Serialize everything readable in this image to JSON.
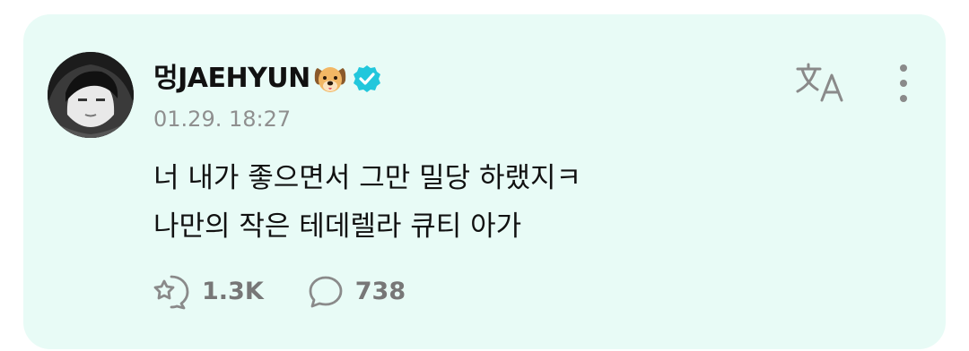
{
  "post": {
    "author": {
      "name": "멍JAEHYUN",
      "emoji_icon": "dog-face-icon",
      "verified_icon": "verified-badge-icon"
    },
    "timestamp": "01.29. 18:27",
    "text_lines": [
      "너 내가 좋으면서 그만 밀당 하랬지ㅋ",
      "나만의 작은 테데렐라 큐티 아가"
    ],
    "actions": {
      "reactions_icon": "reaction-icon",
      "reactions_count": "1.3K",
      "comments_icon": "comment-icon",
      "comments_count": "738"
    },
    "toolbar": {
      "translate_icon": "translate-icon",
      "more_icon": "more-vertical-icon"
    }
  },
  "colors": {
    "card_background": "#e8fbf6",
    "verified": "#22c7dc",
    "muted_text": "#8f8f8f",
    "icon_gray": "#8a8a8a"
  }
}
